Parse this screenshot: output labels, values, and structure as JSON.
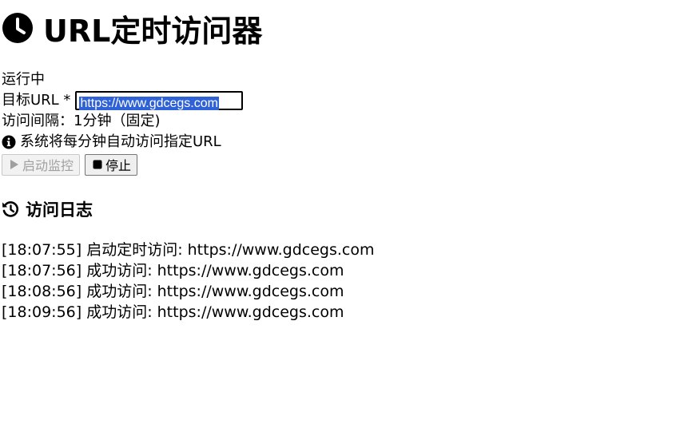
{
  "header": {
    "title": "URL定时访问器",
    "icon": "clock-icon"
  },
  "status": {
    "text": "运行中"
  },
  "target_url": {
    "label": "目标URL *",
    "value": "https://www.gdcegs.com"
  },
  "interval": {
    "text": "访问间隔：1分钟（固定)"
  },
  "info": {
    "icon": "info-circle-icon",
    "text": "系统将每分钟自动访问指定URL"
  },
  "controls": {
    "start_label": "启动监控",
    "start_icon": "play-icon",
    "start_disabled": true,
    "stop_label": "停止",
    "stop_icon": "stop-icon"
  },
  "log": {
    "heading": "访问日志",
    "icon": "history-icon",
    "entries": [
      "[18:07:55] 启动定时访问: https://www.gdcegs.com",
      "[18:07:56] 成功访问: https://www.gdcegs.com",
      "[18:08:56] 成功访问: https://www.gdcegs.com",
      "[18:09:56] 成功访问: https://www.gdcegs.com"
    ]
  },
  "colors": {
    "text": "#000000",
    "selection": "#2f62d6",
    "disabled_text": "#a0a0a0",
    "button_bg": "#efefef"
  }
}
